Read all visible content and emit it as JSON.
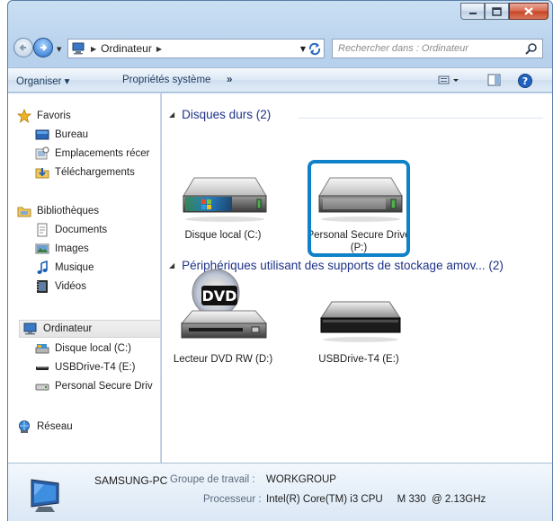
{
  "window": {
    "caption_buttons": [
      "minimize-icon",
      "maximize-icon",
      "close-icon"
    ]
  },
  "address": {
    "location": "Ordinateur",
    "search_placeholder": "Rechercher dans : Ordinateur"
  },
  "toolbar": {
    "organise_label": "Organiser ▾",
    "properties_label": "Propriétés système",
    "more_label": "»"
  },
  "nav_pane": {
    "favorites": {
      "label": "Favoris",
      "items": [
        "Bureau",
        "Emplacements récer",
        "Téléchargements"
      ]
    },
    "libraries": {
      "label": "Bibliothèques",
      "items": [
        "Documents",
        "Images",
        "Musique",
        "Vidéos"
      ]
    },
    "computer": {
      "label": "Ordinateur",
      "items": [
        "Disque local (C:)",
        "USBDrive-T4 (E:)",
        "Personal Secure Driv"
      ]
    },
    "network": {
      "label": "Réseau"
    }
  },
  "content": {
    "hard_disks": {
      "header": "Disques durs (2)",
      "drives": [
        {
          "label": "Disque local (C:)",
          "icon": "hard-drive-windows-icon"
        },
        {
          "label": "Personal Secure Drive (P:)",
          "icon": "hard-drive-icon"
        }
      ]
    },
    "removable": {
      "header": "Périphériques utilisant des supports de stockage amov... (2)",
      "drives": [
        {
          "label": "Lecteur DVD RW (D:)",
          "icon": "dvd-drive-icon"
        },
        {
          "label": "USBDrive-T4 (E:)",
          "icon": "usb-drive-icon"
        }
      ]
    }
  },
  "details": {
    "computer_name": "SAMSUNG-PC",
    "workgroup_key": "Groupe de travail :",
    "workgroup_value": "WORKGROUP",
    "processor_key": "Processeur :",
    "processor_value": "Intel(R) Core(TM) i3 CPU     M 330  @ 2.13GHz"
  },
  "colors": {
    "highlight": "#0e81c8",
    "group_header": "#1e3287"
  }
}
